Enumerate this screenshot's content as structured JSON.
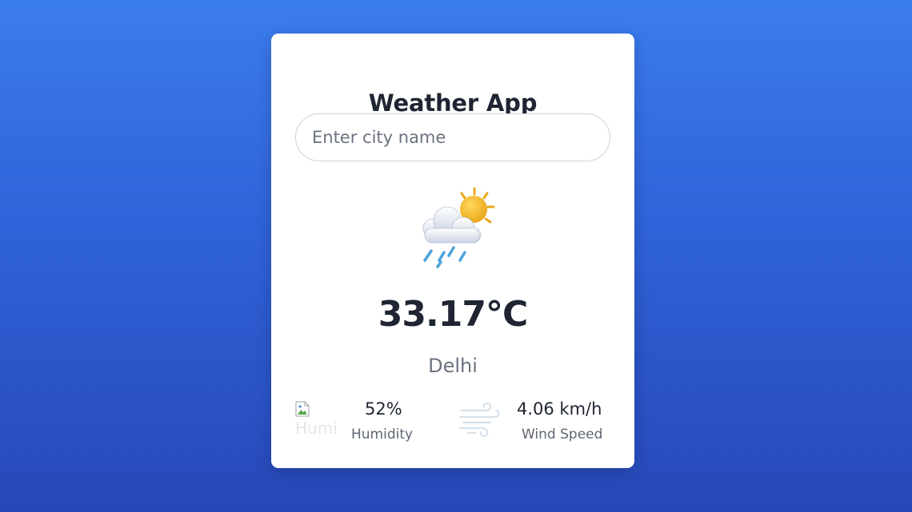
{
  "app": {
    "title": "Weather App"
  },
  "search": {
    "placeholder": "Enter city name",
    "value": ""
  },
  "weather": {
    "icon": "sun-cloud-rain-icon",
    "temperature": "33.17°C",
    "city": "Delhi"
  },
  "stats": {
    "humidity": {
      "icon": "humidity-icon",
      "alt": "Humidity",
      "value": "52%",
      "label": "Humidity"
    },
    "wind": {
      "icon": "wind-icon",
      "value": "4.06 km/h",
      "label": "Wind Speed"
    }
  },
  "colors": {
    "background_top": "#3b7cec",
    "background_bottom": "#2748b8",
    "card": "#ffffff",
    "text_primary": "#1f2532",
    "text_secondary": "#6b7280"
  }
}
